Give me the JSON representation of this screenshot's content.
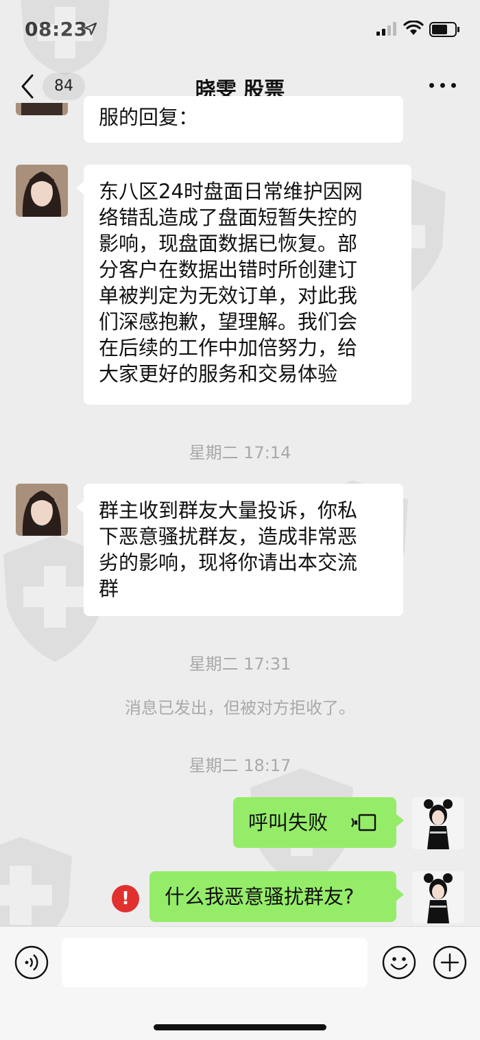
{
  "status_bar": {
    "time": "08:23"
  },
  "nav": {
    "unread_count": "84",
    "title": "晓雯 股票"
  },
  "messages": {
    "partial": {
      "text": "服的回复："
    },
    "m1": {
      "text": "东八区24时盘面日常维护因网\n络错乱造成了盘面短暂失控的\n影响，现盘面数据已恢复。部\n分客户在数据出错时所创建订\n单被判定为无效订单，对此我\n们深感抱歉，望理解。我们会\n在后续的工作中加倍努力，给\n大家更好的服务和交易体验"
    },
    "ts1": "星期二 17:14",
    "m2": {
      "text": "群主收到群友大量投诉，你私\n下恶意骚扰群友，造成非常恶\n劣的影响，现将你请出本交流\n群"
    },
    "ts2": "星期二 17:31",
    "system_note": "消息已发出，但被对方拒收了。",
    "ts3": "星期二 18:17",
    "m3": {
      "text": "呼叫失败"
    },
    "m4": {
      "text": "什么我恶意骚扰群友?"
    },
    "error_mark": "!"
  },
  "colors": {
    "background": "#ededed",
    "sent_bubble": "#95ec69",
    "received_bubble": "#ffffff",
    "error": "#e0312f"
  },
  "icons": [
    "location-arrow-icon",
    "signal-icon",
    "wifi-icon",
    "battery-icon",
    "back-chevron-icon",
    "more-icon",
    "phone-call-icon",
    "error-icon",
    "voice-icon",
    "emoji-icon",
    "plus-icon"
  ]
}
